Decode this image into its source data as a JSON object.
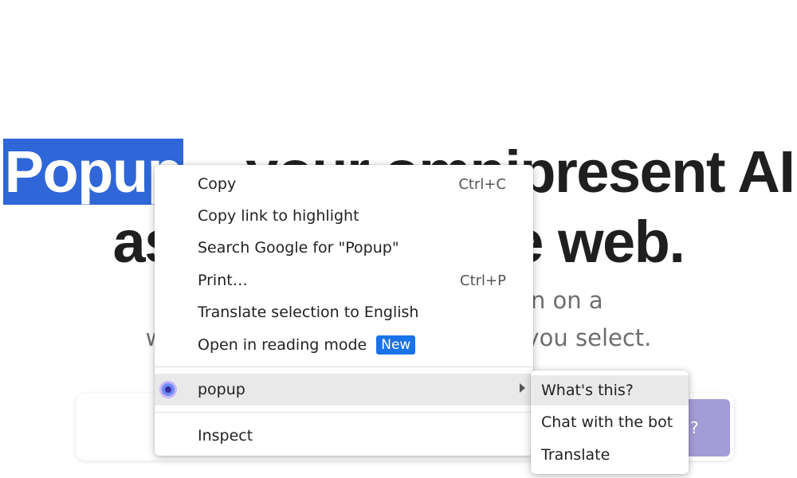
{
  "page": {
    "hero_title_selected": "Popup",
    "hero_title_line1_rest": " – your omnipresent AI",
    "hero_title_line2": "assistant on the web.",
    "hero_subtitle_line1": "Popup appears at any location on a",
    "hero_subtitle_line2": "webpage, alongside the content you select.",
    "cta_button_label": "?",
    "selection_color": "#2f67d8",
    "cta_color": "#a49cd6"
  },
  "context_menu": {
    "items": [
      {
        "label": "Copy",
        "shortcut": "Ctrl+C"
      },
      {
        "label": "Copy link to highlight",
        "shortcut": ""
      },
      {
        "label": "Search Google for \"Popup\"",
        "shortcut": ""
      },
      {
        "label": "Print…",
        "shortcut": "Ctrl+P"
      },
      {
        "label": "Translate selection to English",
        "shortcut": ""
      },
      {
        "label": "Open in reading mode",
        "shortcut": "",
        "badge": "New"
      }
    ],
    "extension_item": {
      "label": "popup",
      "icon": "popup-extension-icon",
      "has_submenu": true
    },
    "inspect_label": "Inspect",
    "badge_color": "#1a73e8"
  },
  "submenu": {
    "items": [
      {
        "label": "What's this?"
      },
      {
        "label": "Chat with the bot"
      },
      {
        "label": "Translate"
      }
    ]
  }
}
